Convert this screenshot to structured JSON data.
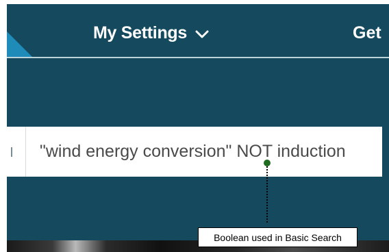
{
  "nav": {
    "settings_label": "My Settings",
    "get_label": "Get",
    "settings_icon": "chevron-down-icon"
  },
  "search": {
    "value": "\"wind energy conversion\" NOT induction"
  },
  "annotation": {
    "label": "Boolean used in Basic Search"
  },
  "colors": {
    "nav_background": "#154a5e",
    "accent_corner": "#1f8bb8",
    "annotation_dot": "#1f6b1f"
  }
}
